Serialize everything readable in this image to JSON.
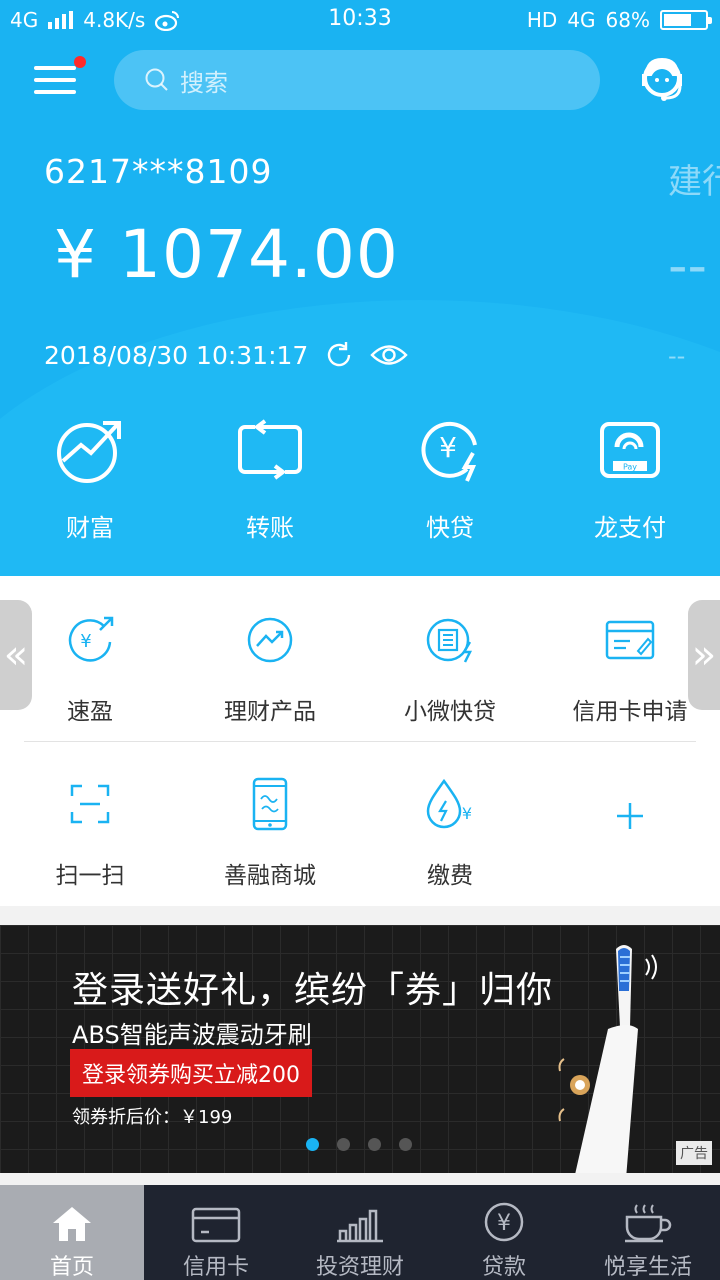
{
  "status_bar": {
    "network": "4G",
    "speed": "4.8K/s",
    "time": "10:33",
    "hd": "HD",
    "net2": "4G",
    "battery_text": "68%",
    "battery_level": 0.68
  },
  "header": {
    "search_placeholder": "搜索",
    "menu_has_notification": true
  },
  "account": {
    "card_number": "6217***8109",
    "balance": "¥ 1074.00",
    "timestamp": "2018/08/30 10:31:17",
    "next_card_title": "建行",
    "next_card_balance": "--",
    "next_card_dash": "--"
  },
  "quick_actions": [
    {
      "label": "财富",
      "icon": "wealth-icon"
    },
    {
      "label": "转账",
      "icon": "transfer-icon"
    },
    {
      "label": "快贷",
      "icon": "quick-loan-icon"
    },
    {
      "label": "龙支付",
      "icon": "dragon-pay-icon"
    }
  ],
  "services": {
    "row1": [
      {
        "label": "速盈",
        "icon": "suying-icon"
      },
      {
        "label": "理财产品",
        "icon": "finance-product-icon"
      },
      {
        "label": "小微快贷",
        "icon": "small-loan-icon"
      },
      {
        "label": "信用卡申请",
        "icon": "credit-card-apply-icon"
      }
    ],
    "row2": [
      {
        "label": "扫一扫",
        "icon": "scan-icon"
      },
      {
        "label": "善融商城",
        "icon": "mall-icon"
      },
      {
        "label": "缴费",
        "icon": "payment-icon"
      }
    ]
  },
  "banner": {
    "headline": "登录送好礼，缤纷「券」归你",
    "product": "ABS智能声波震动牙刷",
    "cta": "登录领券购买立减200",
    "price": "领券折后价：￥199",
    "ad_tag": "广告",
    "active_slide": 1,
    "slide_count": 4
  },
  "tabbar": [
    {
      "label": "首页",
      "icon": "home-icon",
      "active": true
    },
    {
      "label": "信用卡",
      "icon": "credit-card-icon",
      "active": false
    },
    {
      "label": "投资理财",
      "icon": "investment-icon",
      "active": false
    },
    {
      "label": "贷款",
      "icon": "loan-icon",
      "active": false
    },
    {
      "label": "悦享生活",
      "icon": "coffee-icon",
      "active": false
    }
  ],
  "colors": {
    "primary_blue": "#1ab3f2",
    "tab_active_bg": "#a9acb2",
    "tab_bar_bg": "#1f2430",
    "cta_red": "#d91a1a",
    "notification_red": "#ff2a2a"
  }
}
